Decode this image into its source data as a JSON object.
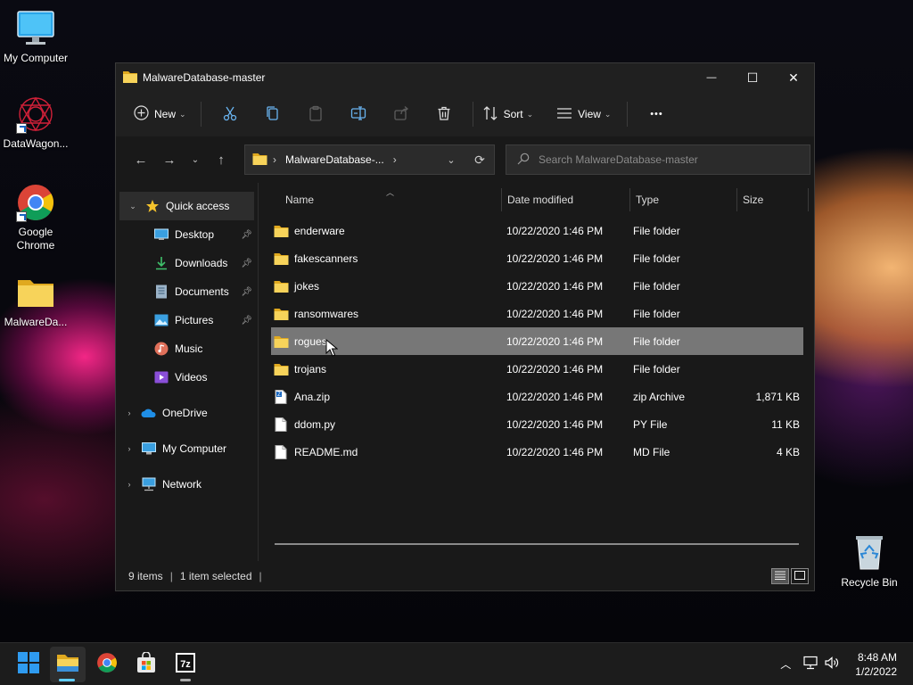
{
  "desktop": {
    "icons": [
      {
        "label": "My Computer"
      },
      {
        "label": "DataWagon..."
      },
      {
        "label": "Google Chrome"
      },
      {
        "label": "MalwareDa..."
      },
      {
        "label": "Recycle Bin"
      }
    ]
  },
  "window": {
    "title": "MalwareDatabase-master",
    "minimize": "—",
    "maximize": "☐",
    "close": "✕"
  },
  "toolbar": {
    "new_label": "New",
    "sort_label": "Sort",
    "view_label": "View",
    "more_label": "•••"
  },
  "address": {
    "crumb": "MalwareDatabase-...",
    "search_placeholder": "Search MalwareDatabase-master"
  },
  "nav": {
    "quick_access": "Quick access",
    "quick_items": [
      {
        "label": "Desktop",
        "pinned": true
      },
      {
        "label": "Downloads",
        "pinned": true
      },
      {
        "label": "Documents",
        "pinned": true
      },
      {
        "label": "Pictures",
        "pinned": true
      },
      {
        "label": "Music",
        "pinned": false
      },
      {
        "label": "Videos",
        "pinned": false
      }
    ],
    "onedrive": "OneDrive",
    "my_computer": "My Computer",
    "network": "Network"
  },
  "columns": {
    "name": "Name",
    "date": "Date modified",
    "type": "Type",
    "size": "Size"
  },
  "files": [
    {
      "name": "enderware",
      "date": "10/22/2020 1:46 PM",
      "type": "File folder",
      "size": "",
      "icon": "folder-icon"
    },
    {
      "name": "fakescanners",
      "date": "10/22/2020 1:46 PM",
      "type": "File folder",
      "size": "",
      "icon": "folder-icon"
    },
    {
      "name": "jokes",
      "date": "10/22/2020 1:46 PM",
      "type": "File folder",
      "size": "",
      "icon": "folder-icon"
    },
    {
      "name": "ransomwares",
      "date": "10/22/2020 1:46 PM",
      "type": "File folder",
      "size": "",
      "icon": "folder-icon"
    },
    {
      "name": "rogues",
      "date": "10/22/2020 1:46 PM",
      "type": "File folder",
      "size": "",
      "icon": "folder-icon",
      "selected": true
    },
    {
      "name": "trojans",
      "date": "10/22/2020 1:46 PM",
      "type": "File folder",
      "size": "",
      "icon": "folder-icon"
    },
    {
      "name": "Ana.zip",
      "date": "10/22/2020 1:46 PM",
      "type": "zip Archive",
      "size": "1,871 KB",
      "icon": "zip-icon"
    },
    {
      "name": "ddom.py",
      "date": "10/22/2020 1:46 PM",
      "type": "PY File",
      "size": "11 KB",
      "icon": "file-icon"
    },
    {
      "name": "README.md",
      "date": "10/22/2020 1:46 PM",
      "type": "MD File",
      "size": "4 KB",
      "icon": "file-icon"
    }
  ],
  "status": {
    "items": "9 items",
    "selected": "1 item selected"
  },
  "clock": {
    "time": "8:48 AM",
    "date": "1/2/2022"
  },
  "colors": {
    "folder": "#f2c744",
    "accent": "#60cdff",
    "selection": "#777777"
  }
}
